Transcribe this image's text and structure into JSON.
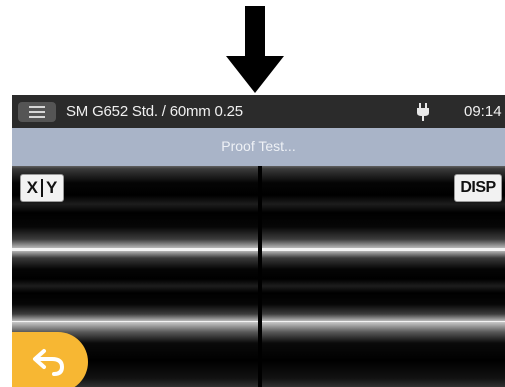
{
  "header": {
    "program_name": "SM G652 Std. / 60mm 0.25",
    "clock": "09:14",
    "menu_icon": "hamburger-menu-icon",
    "power_icon": "ac-plug-icon"
  },
  "status": {
    "message": "Proof Test..."
  },
  "fiber_view": {
    "xy_label_left": "X",
    "xy_label_right": "Y",
    "disp_label": "DISP"
  },
  "back_button": {
    "icon": "back-arrow-icon",
    "color": "#f7b733"
  },
  "colors": {
    "status_bar": "#a9b4c8",
    "top_bar": "#2b2b2b"
  }
}
